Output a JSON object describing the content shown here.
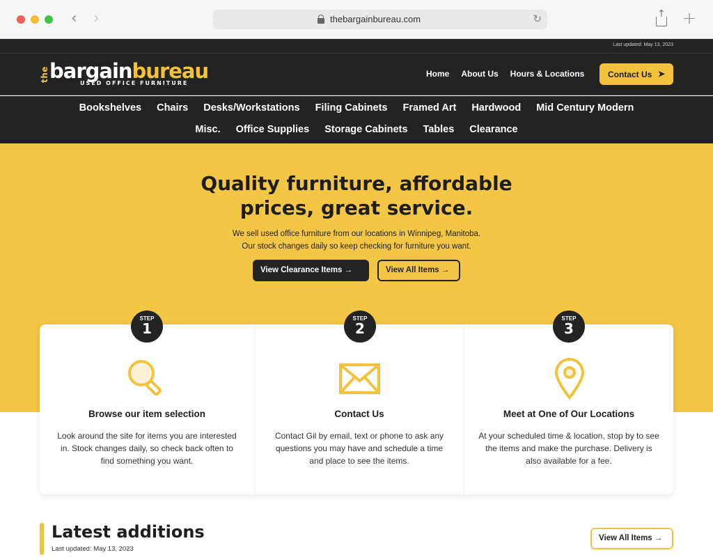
{
  "browser": {
    "url": "thebargainbureau.com",
    "back_glyph": "‹",
    "forward_glyph": "›",
    "reload_glyph": "↻",
    "new_tab_glyph": "+"
  },
  "site": {
    "last_updated_top": "Last updated: May 13, 2023",
    "logo": {
      "the": "the",
      "bargain": "bargain",
      "bureau": "bureau",
      "tagline": "USED OFFICE FURNITURE"
    },
    "nav": [
      {
        "label": "Home"
      },
      {
        "label": "About Us"
      },
      {
        "label": "Hours & Locations"
      }
    ],
    "contact_button": "Contact Us",
    "categories_row1": [
      "Bookshelves",
      "Chairs",
      "Desks/Workstations",
      "Filing Cabinets",
      "Framed Art",
      "Hardwood",
      "Mid Century Modern"
    ],
    "categories_row2": [
      "Misc.",
      "Office Supplies",
      "Storage Cabinets",
      "Tables",
      "Clearance"
    ]
  },
  "hero": {
    "title_line1": "Quality furniture, affordable",
    "title_line2": "prices, great service.",
    "sub_line1": "We sell used office furniture from our locations in Winnipeg, Manitoba.",
    "sub_line2": "Our stock changes daily so keep checking for furniture you want.",
    "btn_clearance": "View Clearance Items",
    "btn_all": "View All Items",
    "arrow": "→"
  },
  "steps": [
    {
      "badge_label": "STEP",
      "number": "1",
      "icon": "magnifier-icon",
      "title": "Browse our item selection",
      "text": "Look around the site for items you are interested in. Stock changes daily, so check back often to find something you want."
    },
    {
      "badge_label": "STEP",
      "number": "2",
      "icon": "envelope-icon",
      "title": "Contact Us",
      "text": "Contact Gil by email, text or phone to ask any questions you may have and schedule a time and place to see the items."
    },
    {
      "badge_label": "STEP",
      "number": "3",
      "icon": "map-pin-icon",
      "title": "Meet at One of Our Locations",
      "text": "At your scheduled time & location, stop by to see the items and make the purchase. Delivery is also available for a fee."
    }
  ],
  "latest": {
    "title": "Latest additions",
    "updated": "Last updated: May 13, 2023",
    "button": "View All Items"
  },
  "colors": {
    "accent": "#f2c23d",
    "hero_bg": "#f4c645",
    "dark": "#232323"
  }
}
